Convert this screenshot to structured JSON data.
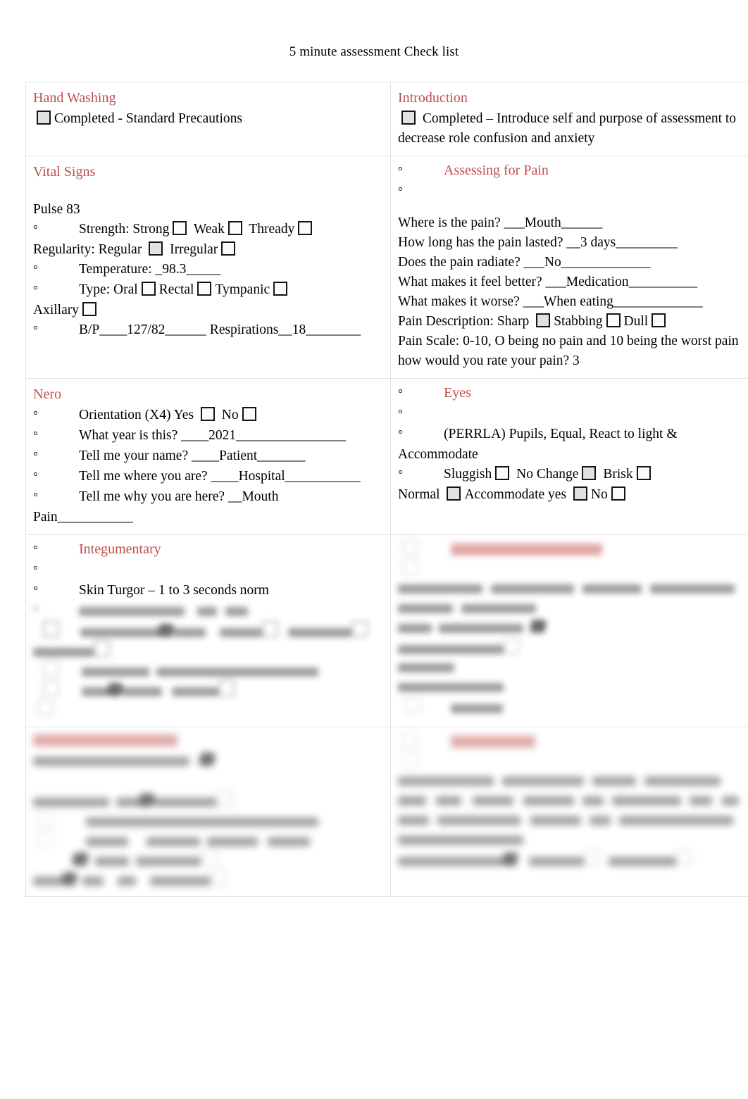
{
  "document": {
    "title": "5 minute assessment Check list"
  },
  "accent_color": "#c0504d",
  "cells": {
    "hand_washing": {
      "heading": "Hand Washing",
      "item": "Completed - Standard Precautions"
    },
    "introduction": {
      "heading": "Introduction",
      "item": "Completed – Introduce self and purpose of assessment to decrease role confusion and anxiety"
    },
    "vital_signs": {
      "heading": "Vital Signs",
      "pulse": "Pulse 83",
      "strength_label": "Strength: Strong",
      "strength_weak": "Weak",
      "strength_thready": "Thready",
      "regularity_label": "Regularity: Regular",
      "regularity_irregular": "Irregular",
      "temperature": "Temperature: _98.3_____",
      "type_label": "Type: Oral",
      "type_rectal": "Rectal",
      "type_tympanic": "Tympanic",
      "type_axillary": "Axillary",
      "bp_resp": "B/P____127/82______ Respirations__18________"
    },
    "assessing_for_pain": {
      "heading": "Assessing for Pain",
      "where": "Where is the pain? ___Mouth______",
      "how_long": "How long has the pain lasted? __3 days_________",
      "radiate": "Does the pain radiate? ___No_____________",
      "better": "What makes it feel better? ___Medication__________",
      "worse": "What makes it worse? ___When eating_____________",
      "description_label": "Pain Description: Sharp",
      "description_stabbing": "Stabbing",
      "description_dull": "Dull",
      "scale": "Pain Scale: 0-10, O being no pain and 10 being the worst pain how would you rate your pain? 3"
    },
    "nero": {
      "heading": "Nero",
      "orientation": "Orientation (X4) Yes",
      "orientation_no": "No",
      "year": "What year is this? ____2021________________",
      "name": "Tell me your name? ____Patient_______",
      "where": "Tell me where you are? ____Hospital___________",
      "why": "Tell me why you are here? __Mouth",
      "pain": "Pain___________"
    },
    "eyes": {
      "heading": "Eyes",
      "perrla": "(PERRLA) Pupils, Equal, React to light & Accommodate",
      "sluggish": "Sluggish",
      "no_change": "No Change",
      "brisk": "Brisk",
      "normal": "Normal",
      "accommodate_yes": "Accommodate yes",
      "accommodate_no": "No"
    },
    "integumentary": {
      "heading": "Integumentary",
      "skin_turgor": "Skin Turgor – 1 to 3 seconds norm",
      "illegible_note": "remaining lines in this cell are blurred and unreadable in the source image"
    },
    "blurred_right_middle": {
      "heading_illegible": true,
      "illegible_note": "entire cell is blurred and unreadable in the source image"
    },
    "blurred_bottom_left": {
      "heading_illegible": true,
      "illegible_note": "entire cell is blurred and unreadable in the source image"
    },
    "blurred_bottom_right": {
      "heading_illegible": true,
      "illegible_note": "entire cell is blurred and unreadable in the source image"
    }
  }
}
